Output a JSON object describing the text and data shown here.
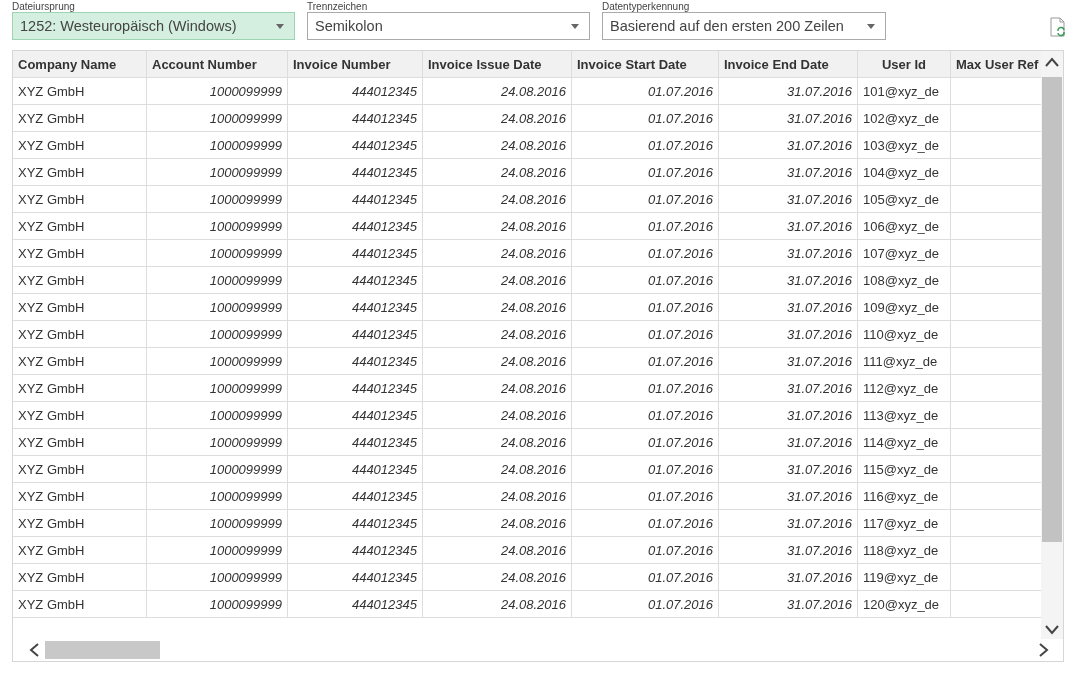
{
  "settings": [
    {
      "label": "Dateiursprung",
      "value": "1252: Westeuropäisch (Windows)",
      "focused": true
    },
    {
      "label": "Trennzeichen",
      "value": "Semikolon",
      "focused": false
    },
    {
      "label": "Datentyperkennung",
      "value": "Basierend auf den ersten 200 Zeilen",
      "focused": false
    }
  ],
  "table": {
    "columns": [
      {
        "label": "Company Name",
        "kind": "text"
      },
      {
        "label": "Account Number",
        "kind": "number"
      },
      {
        "label": "Invoice Number",
        "kind": "number"
      },
      {
        "label": "Invoice Issue Date",
        "kind": "number"
      },
      {
        "label": "Invoice Start Date",
        "kind": "number"
      },
      {
        "label": "Invoice End Date",
        "kind": "number"
      },
      {
        "label": "User Id",
        "kind": "text"
      },
      {
        "label": "Max User Ref",
        "kind": "text"
      }
    ],
    "rows": [
      [
        "XYZ GmbH",
        "1000099999",
        "444012345",
        "24.08.2016",
        "01.07.2016",
        "31.07.2016",
        "101@xyz_de"
      ],
      [
        "XYZ GmbH",
        "1000099999",
        "444012345",
        "24.08.2016",
        "01.07.2016",
        "31.07.2016",
        "102@xyz_de"
      ],
      [
        "XYZ GmbH",
        "1000099999",
        "444012345",
        "24.08.2016",
        "01.07.2016",
        "31.07.2016",
        "103@xyz_de"
      ],
      [
        "XYZ GmbH",
        "1000099999",
        "444012345",
        "24.08.2016",
        "01.07.2016",
        "31.07.2016",
        "104@xyz_de"
      ],
      [
        "XYZ GmbH",
        "1000099999",
        "444012345",
        "24.08.2016",
        "01.07.2016",
        "31.07.2016",
        "105@xyz_de"
      ],
      [
        "XYZ GmbH",
        "1000099999",
        "444012345",
        "24.08.2016",
        "01.07.2016",
        "31.07.2016",
        "106@xyz_de"
      ],
      [
        "XYZ GmbH",
        "1000099999",
        "444012345",
        "24.08.2016",
        "01.07.2016",
        "31.07.2016",
        "107@xyz_de"
      ],
      [
        "XYZ GmbH",
        "1000099999",
        "444012345",
        "24.08.2016",
        "01.07.2016",
        "31.07.2016",
        "108@xyz_de"
      ],
      [
        "XYZ GmbH",
        "1000099999",
        "444012345",
        "24.08.2016",
        "01.07.2016",
        "31.07.2016",
        "109@xyz_de"
      ],
      [
        "XYZ GmbH",
        "1000099999",
        "444012345",
        "24.08.2016",
        "01.07.2016",
        "31.07.2016",
        "110@xyz_de"
      ],
      [
        "XYZ GmbH",
        "1000099999",
        "444012345",
        "24.08.2016",
        "01.07.2016",
        "31.07.2016",
        "111@xyz_de"
      ],
      [
        "XYZ GmbH",
        "1000099999",
        "444012345",
        "24.08.2016",
        "01.07.2016",
        "31.07.2016",
        "112@xyz_de"
      ],
      [
        "XYZ GmbH",
        "1000099999",
        "444012345",
        "24.08.2016",
        "01.07.2016",
        "31.07.2016",
        "113@xyz_de"
      ],
      [
        "XYZ GmbH",
        "1000099999",
        "444012345",
        "24.08.2016",
        "01.07.2016",
        "31.07.2016",
        "114@xyz_de"
      ],
      [
        "XYZ GmbH",
        "1000099999",
        "444012345",
        "24.08.2016",
        "01.07.2016",
        "31.07.2016",
        "115@xyz_de"
      ],
      [
        "XYZ GmbH",
        "1000099999",
        "444012345",
        "24.08.2016",
        "01.07.2016",
        "31.07.2016",
        "116@xyz_de"
      ],
      [
        "XYZ GmbH",
        "1000099999",
        "444012345",
        "24.08.2016",
        "01.07.2016",
        "31.07.2016",
        "117@xyz_de"
      ],
      [
        "XYZ GmbH",
        "1000099999",
        "444012345",
        "24.08.2016",
        "01.07.2016",
        "31.07.2016",
        "118@xyz_de"
      ],
      [
        "XYZ GmbH",
        "1000099999",
        "444012345",
        "24.08.2016",
        "01.07.2016",
        "31.07.2016",
        "119@xyz_de"
      ],
      [
        "XYZ GmbH",
        "1000099999",
        "444012345",
        "24.08.2016",
        "01.07.2016",
        "31.07.2016",
        "120@xyz_de"
      ]
    ]
  }
}
